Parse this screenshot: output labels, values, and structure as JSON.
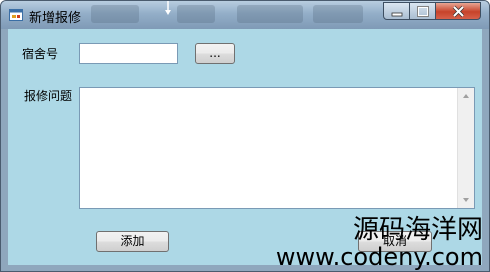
{
  "window": {
    "title": "新增报修",
    "icon": "app-form-icon",
    "controls": [
      "minimize-icon",
      "maximize-icon",
      "close-icon"
    ]
  },
  "form": {
    "dorm_label": "宿舍号",
    "dorm_value": "",
    "browse_label": "...",
    "issue_label": "报修问题",
    "issue_value": "",
    "add_label": "添加",
    "cancel_label": "取消"
  },
  "watermark": {
    "line1": "源码海洋网",
    "line2": "www.codeny.com"
  },
  "colors": {
    "client_bg": "#add8e6",
    "close_button": "#c7432a"
  }
}
